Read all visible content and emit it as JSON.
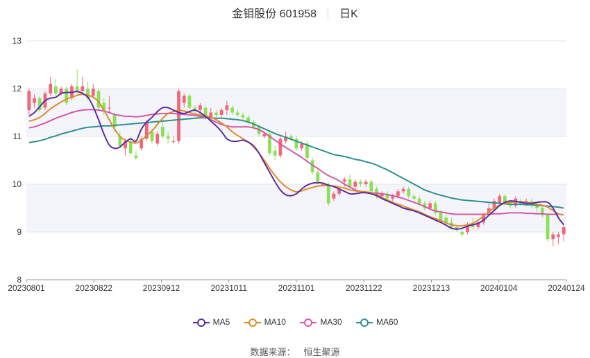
{
  "header": {
    "title": "金钼股份 601958",
    "period": "日K"
  },
  "footer": {
    "source_label": "数据来源：",
    "source_name": "恒生聚源"
  },
  "chart_data": {
    "type": "candlestick",
    "x_ticks": [
      "20230801",
      "20230822",
      "20230912",
      "20231011",
      "20231101",
      "20231122",
      "20231213",
      "20240104",
      "20240124"
    ],
    "y_ticks": [
      8,
      9,
      10,
      11,
      12,
      13
    ],
    "ylim": [
      8,
      13
    ],
    "grid": true,
    "legend_position": "bottom",
    "colors": {
      "up": "#f0677a",
      "down": "#8ce055",
      "MA5": "#5b2e9e",
      "MA10": "#e08a2d",
      "MA30": "#d458a8",
      "MA60": "#2f8f8f",
      "band": "#f3f5fb"
    },
    "series": [
      {
        "name": "MA5",
        "values": [
          11.42,
          11.5,
          11.62,
          11.75,
          11.8,
          11.82,
          11.9,
          11.92,
          11.92,
          11.94,
          11.9,
          11.82,
          11.62,
          11.35,
          11.05,
          10.82,
          10.75,
          10.78,
          10.88,
          10.95,
          10.9,
          11.15,
          11.3,
          11.4,
          11.52,
          11.6,
          11.6,
          11.55,
          11.5,
          11.48,
          11.52,
          11.55,
          11.5,
          11.42,
          11.32,
          11.22,
          11.1,
          10.95,
          10.9,
          10.9,
          10.92,
          10.88,
          10.8,
          10.65,
          10.45,
          10.25,
          10.05,
          9.88,
          9.78,
          9.76,
          9.8,
          9.9,
          9.98,
          10.02,
          10.03,
          10.02,
          9.98,
          9.95,
          9.9,
          9.85,
          9.8,
          9.8,
          9.82,
          9.82,
          9.8,
          9.76,
          9.7,
          9.65,
          9.6,
          9.55,
          9.5,
          9.47,
          9.44,
          9.4,
          9.35,
          9.3,
          9.25,
          9.2,
          9.14,
          9.08,
          9.06,
          9.08,
          9.12,
          9.15,
          9.18,
          9.25,
          9.35,
          9.45,
          9.55,
          9.62,
          9.65,
          9.64,
          9.62,
          9.6,
          9.6,
          9.62,
          9.63,
          9.62,
          9.5,
          9.3,
          9.15
        ]
      },
      {
        "name": "MA10",
        "values": [
          11.32,
          11.35,
          11.4,
          11.48,
          11.58,
          11.65,
          11.72,
          11.78,
          11.82,
          11.86,
          11.88,
          11.86,
          11.82,
          11.72,
          11.55,
          11.35,
          11.15,
          11,
          10.92,
          10.88,
          10.86,
          10.92,
          11.02,
          11.12,
          11.25,
          11.38,
          11.48,
          11.52,
          11.55,
          11.53,
          11.5,
          11.47,
          11.45,
          11.43,
          11.4,
          11.35,
          11.28,
          11.2,
          11.1,
          11.02,
          10.95,
          10.88,
          10.78,
          10.65,
          10.5,
          10.33,
          10.18,
          10.05,
          9.95,
          9.88,
          9.84,
          9.86,
          9.9,
          9.93,
          9.96,
          9.97,
          9.97,
          9.96,
          9.94,
          9.92,
          9.88,
          9.86,
          9.85,
          9.84,
          9.82,
          9.78,
          9.72,
          9.67,
          9.62,
          9.58,
          9.54,
          9.5,
          9.46,
          9.42,
          9.37,
          9.32,
          9.28,
          9.24,
          9.19,
          9.15,
          9.13,
          9.13,
          9.15,
          9.18,
          9.25,
          9.33,
          9.42,
          9.5,
          9.56,
          9.6,
          9.62,
          9.63,
          9.63,
          9.62,
          9.6,
          9.58,
          9.56,
          9.52,
          9.45,
          9.38,
          9.36
        ]
      },
      {
        "name": "MA30",
        "values": [
          11.18,
          11.2,
          11.24,
          11.28,
          11.33,
          11.38,
          11.42,
          11.46,
          11.5,
          11.53,
          11.55,
          11.56,
          11.56,
          11.55,
          11.53,
          11.5,
          11.46,
          11.44,
          11.42,
          11.42,
          11.41,
          11.42,
          11.44,
          11.46,
          11.47,
          11.48,
          11.48,
          11.48,
          11.47,
          11.46,
          11.45,
          11.44,
          11.42,
          11.4,
          11.35,
          11.3,
          11.25,
          11.22,
          11.2,
          11.2,
          11.2,
          11.2,
          11.18,
          11.14,
          11.08,
          11,
          10.92,
          10.84,
          10.77,
          10.7,
          10.63,
          10.56,
          10.48,
          10.4,
          10.33,
          10.25,
          10.18,
          10.13,
          10.07,
          10,
          9.94,
          9.88,
          9.85,
          9.83,
          9.82,
          9.81,
          9.8,
          9.78,
          9.76,
          9.73,
          9.7,
          9.66,
          9.62,
          9.58,
          9.53,
          9.48,
          9.44,
          9.42,
          9.4,
          9.38,
          9.37,
          9.37,
          9.37,
          9.37,
          9.37,
          9.37,
          9.37,
          9.38,
          9.38,
          9.39,
          9.4,
          9.4,
          9.4,
          9.39,
          9.39,
          9.38,
          9.38,
          9.37,
          9.37,
          9.37,
          9.36
        ]
      },
      {
        "name": "MA60",
        "values": [
          10.87,
          10.89,
          10.91,
          10.94,
          10.98,
          11.01,
          11.05,
          11.08,
          11.11,
          11.14,
          11.17,
          11.19,
          11.2,
          11.21,
          11.22,
          11.22,
          11.23,
          11.24,
          11.25,
          11.26,
          11.27,
          11.28,
          11.29,
          11.3,
          11.31,
          11.32,
          11.33,
          11.34,
          11.35,
          11.36,
          11.37,
          11.38,
          11.39,
          11.39,
          11.39,
          11.38,
          11.38,
          11.37,
          11.36,
          11.35,
          11.33,
          11.3,
          11.26,
          11.21,
          11.16,
          11.11,
          11.06,
          11.02,
          10.98,
          10.94,
          10.9,
          10.86,
          10.82,
          10.78,
          10.74,
          10.7,
          10.66,
          10.62,
          10.6,
          10.58,
          10.55,
          10.52,
          10.5,
          10.47,
          10.44,
          10.4,
          10.35,
          10.3,
          10.24,
          10.18,
          10.12,
          10.06,
          10,
          9.94,
          9.88,
          9.84,
          9.8,
          9.77,
          9.74,
          9.71,
          9.69,
          9.67,
          9.66,
          9.65,
          9.64,
          9.63,
          9.62,
          9.61,
          9.6,
          9.59,
          9.58,
          9.58,
          9.58,
          9.57,
          9.57,
          9.56,
          9.55,
          9.54,
          9.53,
          9.52,
          9.5
        ]
      }
    ],
    "candles": [
      [
        11.55,
        11.95,
        11.45,
        12.0
      ],
      [
        11.7,
        11.8,
        11.6,
        11.88
      ],
      [
        11.8,
        11.55,
        11.5,
        11.85
      ],
      [
        11.6,
        11.9,
        11.55,
        11.95
      ],
      [
        11.9,
        12.1,
        11.85,
        12.25
      ],
      [
        12.05,
        11.9,
        11.85,
        12.2
      ],
      [
        11.9,
        12.0,
        11.85,
        12.05
      ],
      [
        12.0,
        11.7,
        11.65,
        12.05
      ],
      [
        11.8,
        12.05,
        11.75,
        12.1
      ],
      [
        12.05,
        11.95,
        11.85,
        12.4
      ],
      [
        11.95,
        12.05,
        11.9,
        12.25
      ],
      [
        12.0,
        11.8,
        11.75,
        12.15
      ],
      [
        11.85,
        12.0,
        11.8,
        12.1
      ],
      [
        11.95,
        11.6,
        11.55,
        12.0
      ],
      [
        11.7,
        11.55,
        11.45,
        11.8
      ],
      [
        11.6,
        11.6,
        11.5,
        11.85
      ],
      [
        11.45,
        11.2,
        11.1,
        11.5
      ],
      [
        11.0,
        10.8,
        10.75,
        11.1
      ],
      [
        10.75,
        10.9,
        10.6,
        10.95
      ],
      [
        10.9,
        10.65,
        10.6,
        11.0
      ],
      [
        10.6,
        10.55,
        10.5,
        10.7
      ],
      [
        10.75,
        10.95,
        10.7,
        11.0
      ],
      [
        10.95,
        11.3,
        10.9,
        11.35
      ],
      [
        11.1,
        10.9,
        10.85,
        11.15
      ],
      [
        10.85,
        11.05,
        10.8,
        11.1
      ],
      [
        11.2,
        11.0,
        10.95,
        11.3
      ],
      [
        11.0,
        10.95,
        10.85,
        11.1
      ],
      [
        10.9,
        10.9,
        10.85,
        11.0
      ],
      [
        10.9,
        11.95,
        10.85,
        12.0
      ],
      [
        11.7,
        11.85,
        11.6,
        11.9
      ],
      [
        11.85,
        11.6,
        11.55,
        11.9
      ],
      [
        11.6,
        11.55,
        11.45,
        11.65
      ],
      [
        11.55,
        11.65,
        11.5,
        11.7
      ],
      [
        11.6,
        11.4,
        11.35,
        11.65
      ],
      [
        11.4,
        11.5,
        11.35,
        11.6
      ],
      [
        11.5,
        11.45,
        11.4,
        11.55
      ],
      [
        11.45,
        11.55,
        11.4,
        11.6
      ],
      [
        11.55,
        11.65,
        11.45,
        11.75
      ],
      [
        11.6,
        11.5,
        11.45,
        11.65
      ],
      [
        11.5,
        11.45,
        11.4,
        11.55
      ],
      [
        11.45,
        11.4,
        11.35,
        11.5
      ],
      [
        11.4,
        11.3,
        11.25,
        11.45
      ],
      [
        11.3,
        11.2,
        11.15,
        11.35
      ],
      [
        11.2,
        11.05,
        11.0,
        11.25
      ],
      [
        11.0,
        11.05,
        10.95,
        11.1
      ],
      [
        11.05,
        10.65,
        10.6,
        11.1
      ],
      [
        10.7,
        10.6,
        10.5,
        10.8
      ],
      [
        10.6,
        10.95,
        10.55,
        11.0
      ],
      [
        10.9,
        11.0,
        10.85,
        11.1
      ],
      [
        11.0,
        10.95,
        10.9,
        11.05
      ],
      [
        10.95,
        10.75,
        10.7,
        11.0
      ],
      [
        10.75,
        10.85,
        10.7,
        10.9
      ],
      [
        10.85,
        10.55,
        10.5,
        10.9
      ],
      [
        10.5,
        10.25,
        10.2,
        10.55
      ],
      [
        10.25,
        10.05,
        10.0,
        10.3
      ],
      [
        10.0,
        10.0,
        9.95,
        10.05
      ],
      [
        10.0,
        9.6,
        9.55,
        10.05
      ],
      [
        9.7,
        9.8,
        9.65,
        9.85
      ],
      [
        9.8,
        9.9,
        9.75,
        9.95
      ],
      [
        10.05,
        10.1,
        9.95,
        10.15
      ],
      [
        10.1,
        9.95,
        9.9,
        10.2
      ],
      [
        9.95,
        10.05,
        9.9,
        10.1
      ],
      [
        10.05,
        10.0,
        9.95,
        10.1
      ],
      [
        10.0,
        10.05,
        9.95,
        10.1
      ],
      [
        10.05,
        9.85,
        9.8,
        10.1
      ],
      [
        9.9,
        9.75,
        9.7,
        9.95
      ],
      [
        9.75,
        9.8,
        9.7,
        9.85
      ],
      [
        9.8,
        9.7,
        9.65,
        9.85
      ],
      [
        9.7,
        9.75,
        9.65,
        9.8
      ],
      [
        9.75,
        9.85,
        9.7,
        9.9
      ],
      [
        9.85,
        9.9,
        9.8,
        9.95
      ],
      [
        9.9,
        9.75,
        9.7,
        9.95
      ],
      [
        9.75,
        9.7,
        9.65,
        9.8
      ],
      [
        9.7,
        9.6,
        9.55,
        9.75
      ],
      [
        9.6,
        9.5,
        9.45,
        9.65
      ],
      [
        9.5,
        9.6,
        9.45,
        9.65
      ],
      [
        9.6,
        9.4,
        9.35,
        9.65
      ],
      [
        9.4,
        9.25,
        9.2,
        9.45
      ],
      [
        9.3,
        9.2,
        9.15,
        9.4
      ],
      [
        9.2,
        9.1,
        9.05,
        9.3
      ],
      [
        9.1,
        9.05,
        9.0,
        9.15
      ],
      [
        9.0,
        8.95,
        8.9,
        9.1
      ],
      [
        9.0,
        9.15,
        8.95,
        9.2
      ],
      [
        9.15,
        9.1,
        9.05,
        9.3
      ],
      [
        9.1,
        9.2,
        9.05,
        9.25
      ],
      [
        9.2,
        9.35,
        9.15,
        9.4
      ],
      [
        9.4,
        9.5,
        9.35,
        9.6
      ],
      [
        9.5,
        9.65,
        9.45,
        9.7
      ],
      [
        9.6,
        9.75,
        9.55,
        9.8
      ],
      [
        9.75,
        9.6,
        9.55,
        9.8
      ],
      [
        9.6,
        9.55,
        9.5,
        9.65
      ],
      [
        9.55,
        9.7,
        9.5,
        9.75
      ],
      [
        9.65,
        9.6,
        9.55,
        9.7
      ],
      [
        9.6,
        9.65,
        9.55,
        9.7
      ],
      [
        9.65,
        9.55,
        9.5,
        9.7
      ],
      [
        9.55,
        9.5,
        9.4,
        9.6
      ],
      [
        9.5,
        9.35,
        9.3,
        9.55
      ],
      [
        9.35,
        8.85,
        8.8,
        9.4
      ],
      [
        8.85,
        8.95,
        8.7,
        9.0
      ],
      [
        8.9,
        8.95,
        8.75,
        9.0
      ],
      [
        8.95,
        9.1,
        8.8,
        9.15
      ]
    ]
  },
  "legend": {
    "items": [
      {
        "label": "MA5",
        "color": "#5b2e9e"
      },
      {
        "label": "MA10",
        "color": "#e08a2d"
      },
      {
        "label": "MA30",
        "color": "#d458a8"
      },
      {
        "label": "MA60",
        "color": "#2f8f8f"
      }
    ]
  }
}
